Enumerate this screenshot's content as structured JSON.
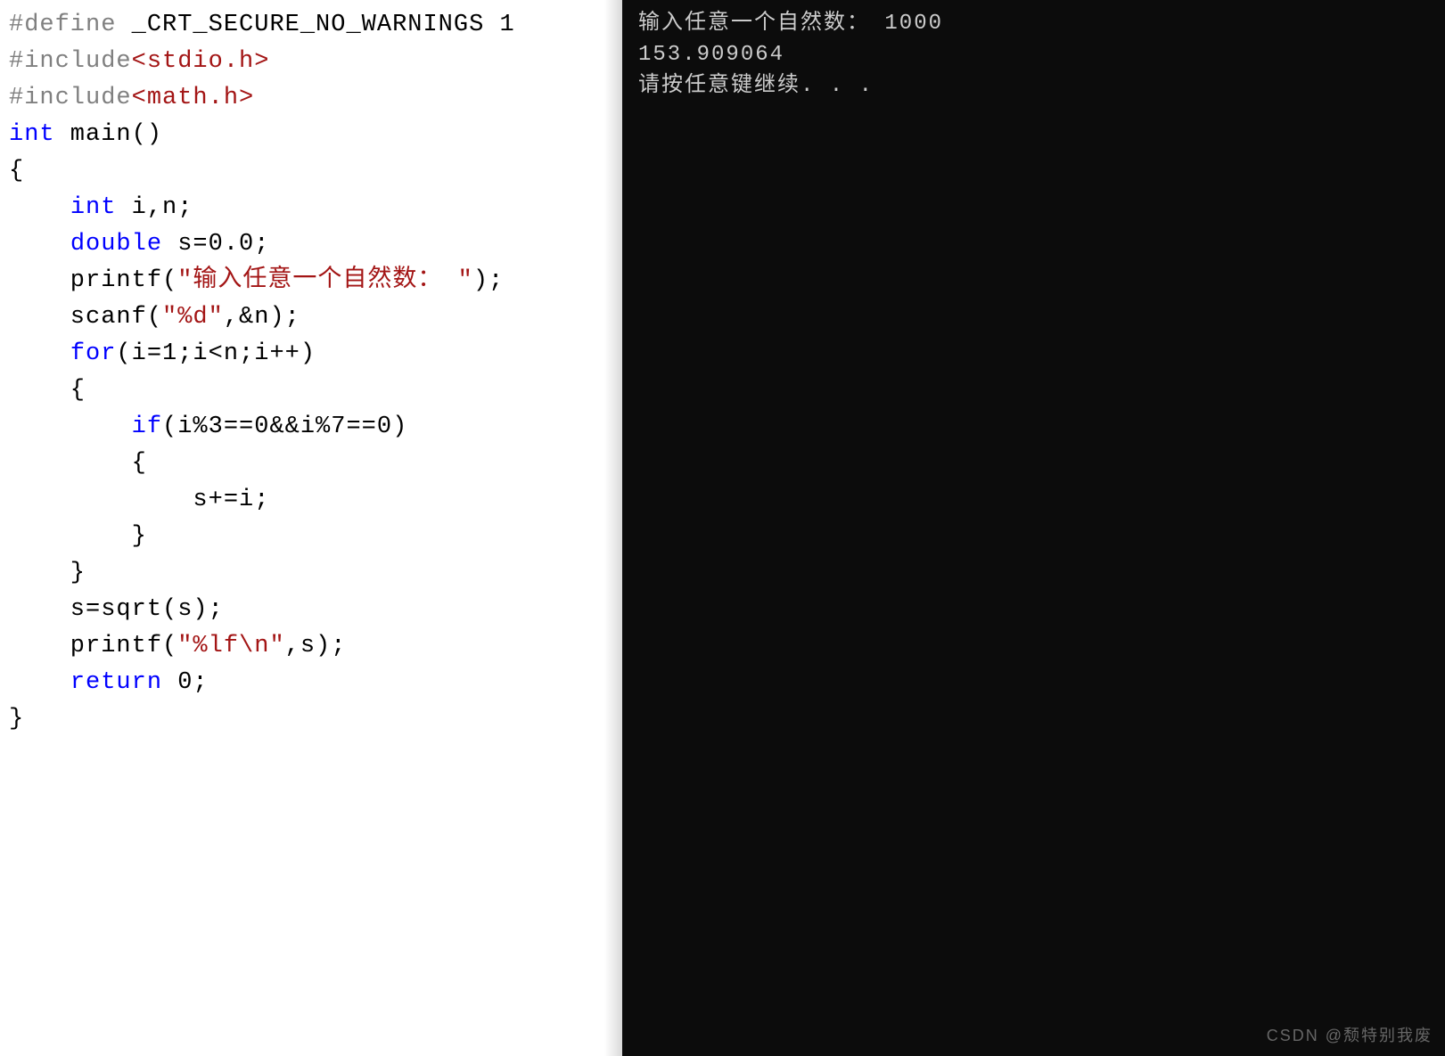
{
  "code": {
    "line1": {
      "part1": "#define",
      "part2": " _CRT_SECURE_NO_WARNINGS 1"
    },
    "line2": "",
    "line3": {
      "part1": "#include",
      "part2": "<stdio.h>"
    },
    "line4": {
      "part1": "#include",
      "part2": "<math.h>"
    },
    "line5": {
      "part1": "int",
      "part2": " main()"
    },
    "line6": "{",
    "line7": {
      "part1": "    ",
      "part2": "int",
      "part3": " i,n;"
    },
    "line8": {
      "part1": "    ",
      "part2": "double",
      "part3": " s=0.0;"
    },
    "line9": {
      "part1": "    printf(",
      "part2": "\"输入任意一个自然数： \"",
      "part3": ");"
    },
    "line10": {
      "part1": "    scanf(",
      "part2": "\"%d\"",
      "part3": ",&n);"
    },
    "line11": {
      "part1": "    ",
      "part2": "for",
      "part3": "(i=1;i<n;i++)"
    },
    "line12": "    {",
    "line13": {
      "part1": "        ",
      "part2": "if",
      "part3": "(i%3==0&&i%7==0)"
    },
    "line14": "        {",
    "line15": "            s+=i;",
    "line16": "        }",
    "line17": "    }",
    "line18": "    s=sqrt(s);",
    "line19": {
      "part1": "    printf(",
      "part2": "\"%lf\\n\"",
      "part3": ",s);"
    },
    "line20": "",
    "line21": {
      "part1": "    ",
      "part2": "return",
      "part3": " 0;"
    },
    "line22": "}"
  },
  "console": {
    "line1": "输入任意一个自然数： 1000",
    "line2": "153.909064",
    "line3": "请按任意键继续. . ."
  },
  "watermark": "CSDN @颓特别我废"
}
